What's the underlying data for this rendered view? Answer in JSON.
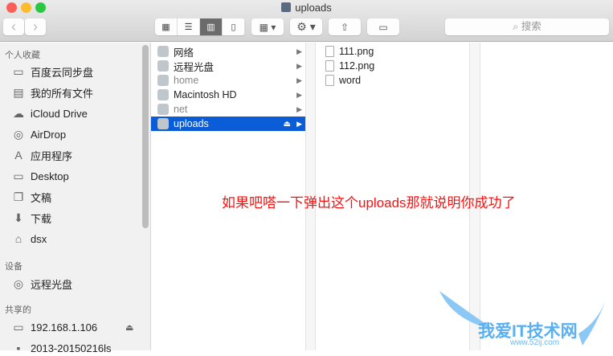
{
  "window": {
    "title": "uploads"
  },
  "toolbar": {
    "back": "‹",
    "forward": "›",
    "view_icons": "▦",
    "view_list": "☰",
    "view_columns": "▥",
    "view_coverflow": "▯",
    "arrange": "▦ ▾",
    "action": "⚙ ▾",
    "share": "⇧",
    "tag": "▭",
    "search_placeholder": "搜索",
    "search_icon": "⌕"
  },
  "sidebar": {
    "favorites_header": "个人收藏",
    "favorites": [
      {
        "label": "百度云同步盘",
        "icon": "folder-icon",
        "glyph": "▭"
      },
      {
        "label": "我的所有文件",
        "icon": "all-files-icon",
        "glyph": "▤"
      },
      {
        "label": "iCloud Drive",
        "icon": "cloud-icon",
        "glyph": "☁"
      },
      {
        "label": "AirDrop",
        "icon": "airdrop-icon",
        "glyph": "◎"
      },
      {
        "label": "应用程序",
        "icon": "applications-icon",
        "glyph": "A"
      },
      {
        "label": "Desktop",
        "icon": "desktop-icon",
        "glyph": "▭"
      },
      {
        "label": "文稿",
        "icon": "documents-icon",
        "glyph": "❐"
      },
      {
        "label": "下载",
        "icon": "downloads-icon",
        "glyph": "⬇"
      },
      {
        "label": "dsx",
        "icon": "home-icon",
        "glyph": "⌂"
      }
    ],
    "devices_header": "设备",
    "devices": [
      {
        "label": "远程光盘",
        "icon": "disc-icon",
        "glyph": "◎"
      }
    ],
    "shared_header": "共享的",
    "shared": [
      {
        "label": "192.168.1.106",
        "icon": "computer-icon",
        "glyph": "▭",
        "eject": "⏏"
      },
      {
        "label": "2013-20150216ls",
        "icon": "computer-icon",
        "glyph": "▪"
      }
    ]
  },
  "column1": [
    {
      "label": "网络",
      "state": "normal",
      "icon": "network-icon"
    },
    {
      "label": "远程光盘",
      "state": "normal",
      "icon": "disc-icon"
    },
    {
      "label": "home",
      "state": "dim",
      "icon": "server-icon"
    },
    {
      "label": "Macintosh HD",
      "state": "normal",
      "icon": "hard-drive-icon"
    },
    {
      "label": "net",
      "state": "dim",
      "icon": "server-icon"
    },
    {
      "label": "uploads",
      "state": "selected",
      "icon": "server-icon",
      "eject": "⏏"
    }
  ],
  "column2": [
    {
      "label": "111.png"
    },
    {
      "label": "112.png"
    },
    {
      "label": "word"
    }
  ],
  "annotation": "如果吧嗒一下弹出这个uploads那就说明你成功了",
  "watermark": {
    "title": "我爱IT技术网",
    "url": "www.52ij.com"
  }
}
